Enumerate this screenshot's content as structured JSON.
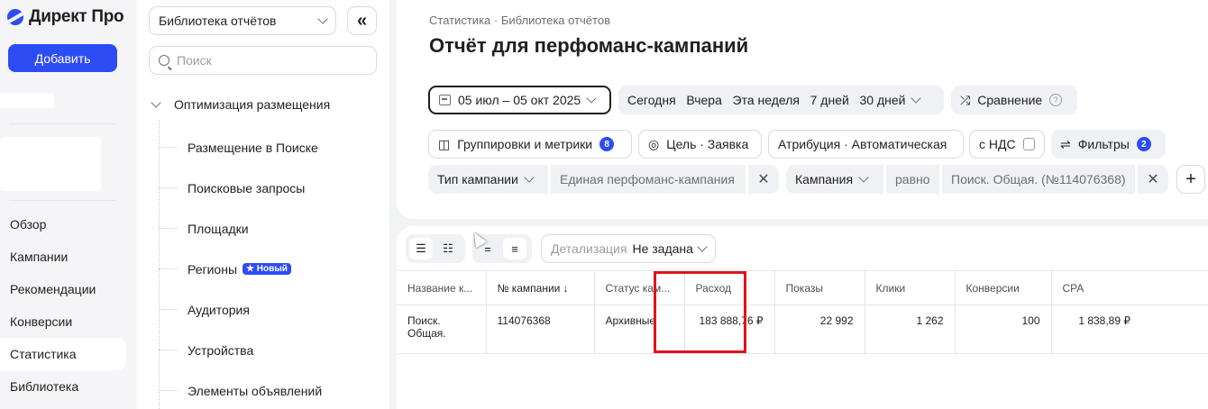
{
  "brand": {
    "name": "Директ Про",
    "accent": "#2e4cf4"
  },
  "leftnav": {
    "add_label": "Добавить",
    "items": [
      "Обзор",
      "Кампании",
      "Рекомендации",
      "Конверсии",
      "Статистика",
      "Библиотека"
    ],
    "active": "Статистика"
  },
  "library": {
    "select_value": "Библиотека отчётов",
    "search_placeholder": "Поиск",
    "root": "Оптимизация размещения",
    "items": [
      "Размещение в Поиске",
      "Поисковые запросы",
      "Площадки",
      "Регионы",
      "Аудитория",
      "Устройства",
      "Элементы объявлений"
    ],
    "new_badge": "★ Новый"
  },
  "header": {
    "breadcrumb": "Статистика · Библиотека отчётов",
    "title": "Отчёт для перфоманс-кампаний"
  },
  "toolbar": {
    "date_range": "05 июл – 05 окт 2025",
    "periods": "Сегодня   Вчера   Эта неделя   7 дней   30 дней",
    "compare": "Сравнение",
    "groupings": "Группировки и метрики",
    "groupings_count": "8",
    "goal": "Цель · Заявка",
    "attribution": "Атрибуция · Автоматическая",
    "vat": "с НДС",
    "filters": "Фильтры",
    "filters_count": "2"
  },
  "filters": {
    "campaign_type_label": "Тип кампании",
    "campaign_type_value": "Единая перфоманс-кампания",
    "campaign_label": "Кампания",
    "campaign_op": "равно",
    "campaign_value": "Поиск. Общая. (№114076368)"
  },
  "table_controls": {
    "detail_label": "Детализация",
    "detail_value": "Не задана"
  },
  "table": {
    "headers": [
      "Название к...",
      "№ кампании ↓",
      "Статус кам...",
      "Расход",
      "Показы",
      "Клики",
      "Конверсии",
      "CPA"
    ],
    "rows": [
      [
        "Поиск. Общая.",
        "114076368",
        "Архивные",
        "183 888,76 ₽",
        "22 992",
        "1 262",
        "100",
        "1 838,89 ₽"
      ]
    ]
  }
}
